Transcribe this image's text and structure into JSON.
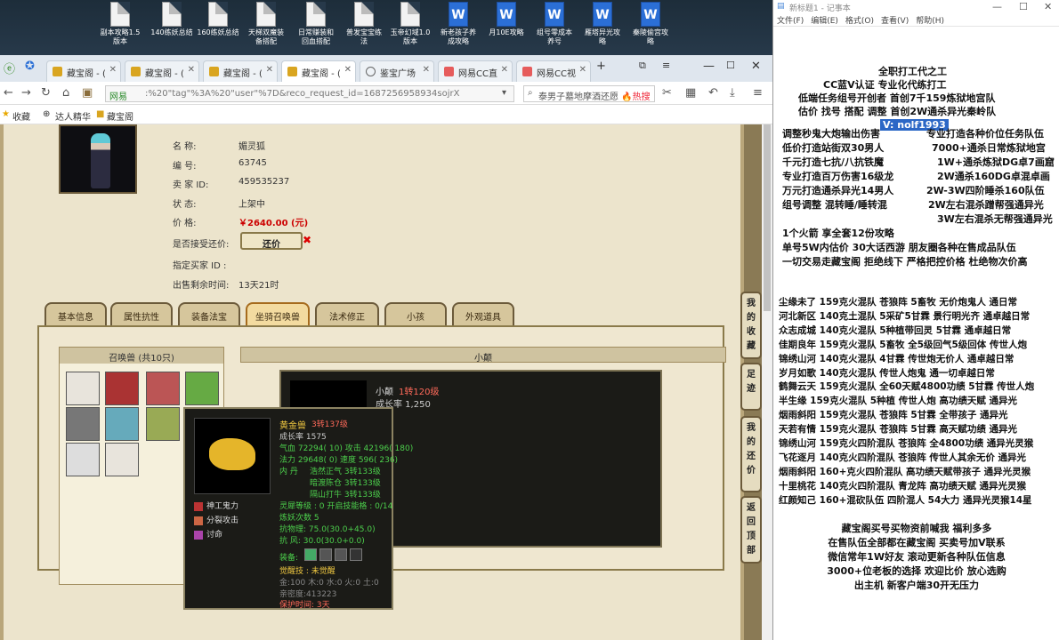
{
  "desktop": {
    "icons": [
      {
        "label": "副本攻略1.5\n版本",
        "icon": "doc-icon",
        "word": false
      },
      {
        "label": "140练妖总结",
        "icon": "doc-icon",
        "word": false
      },
      {
        "label": "160练妖总结",
        "icon": "doc-icon",
        "word": false
      },
      {
        "label": "天梯双魔装\n备搭配",
        "icon": "doc-icon",
        "word": false
      },
      {
        "label": "日常赚装和\n回血搭配",
        "icon": "doc-icon",
        "word": false
      },
      {
        "label": "普发宝宝练\n法",
        "icon": "doc-icon",
        "word": false
      },
      {
        "label": "玉帝幻域1.0\n版本",
        "icon": "doc-icon",
        "word": false
      },
      {
        "label": "新老孩子养\n成攻略",
        "icon": "word-icon",
        "word": true
      },
      {
        "label": "月10E攻略",
        "icon": "word-icon",
        "word": true
      },
      {
        "label": "组号零成本\n养号",
        "icon": "word-icon",
        "word": true
      },
      {
        "label": "雁塔异光攻\n略",
        "icon": "word-icon",
        "word": true
      },
      {
        "label": "秦陵偷宫攻\n略",
        "icon": "word-icon",
        "word": true
      }
    ]
  },
  "browser": {
    "tabs": [
      {
        "label": "藏宝阁 - (",
        "active": false
      },
      {
        "label": "藏宝阁 - (",
        "active": false
      },
      {
        "label": "藏宝阁 - (",
        "active": false
      },
      {
        "label": "藏宝阁 - (",
        "active": true
      },
      {
        "label": "鉴宝广场",
        "active": false
      },
      {
        "label": "网易CC直",
        "active": false
      },
      {
        "label": "网易CC视",
        "active": false
      }
    ],
    "new_tab": "+",
    "address": {
      "site": "网易",
      "url": ":%20\"tag\"%3A%20\"user\"%7D&reco_request_id=1687256958934sojrX"
    },
    "search": {
      "text": "泰男子墓地摩酒还愿",
      "hot": "🔥热搜"
    },
    "bookmarks": [
      "收藏",
      "达人精华",
      "藏宝阁"
    ]
  },
  "item": {
    "labels": [
      "名      称:",
      "编      号:",
      "卖  家  ID:",
      "状      态:",
      "价      格:",
      "是否接受还价:",
      "指定买家 ID :",
      "出售剩余时间:"
    ],
    "name": "媚灵狐",
    "number": "63745",
    "seller_id": "459535237",
    "status": "上架中",
    "price": "￥2640.00 (元)",
    "offer_button": "还价",
    "offer_close": "✖",
    "remaining": "13天21时"
  },
  "game_tabs": [
    "基本信息",
    "属性抗性",
    "装备法宝",
    "坐骑召唤兽",
    "法术修正",
    "小孩",
    "外观道具"
  ],
  "summon_list": {
    "header": "召唤兽 (共10只)"
  },
  "detail_header": "小颠",
  "tooltip_back": {
    "name": "小颠",
    "level": "1转120级",
    "growth": "成长率 1,250"
  },
  "tooltip": {
    "name": "黄金兽",
    "level": "3转137级",
    "growth": "成长率 1575",
    "stats": [
      "气血 72294( 10) 攻击 42196( 180)",
      "法力 29648( 0) 速度 596( 236)"
    ],
    "neidan_label": "内   丹",
    "neidan": [
      "浩然正气 3转133级",
      "暗渡陈仓 3转133级",
      "隔山打牛 3转133级"
    ],
    "skills": [
      "神工鬼力",
      "分裂攻击",
      "讨命"
    ],
    "lingshi": "灵犀等级 : 0  开启技能格 : 0/14",
    "lianyao": "炼妖次数 5",
    "resist1": "抗物理: 75.0(30.0+45.0)",
    "resist2": "抗   风: 30.0(30.0+0.0)",
    "equip_label": "装备:",
    "awaken": "觉醒技 :  未觉醒",
    "elements": "金:100 木:0 水:0 火:0 土:0",
    "intimacy": "亲密度:413223",
    "protect": "保护时间:   3天"
  },
  "side_buttons": [
    "我\n的\n收\n藏",
    "足\n迹",
    "我\n的\n还\n价",
    "返\n回\n顶\n部"
  ],
  "notepad": {
    "title": "新标题1 - 记事本",
    "menu": [
      "文件(F)",
      "编辑(E)",
      "格式(O)",
      "查看(V)",
      "帮助(H)"
    ],
    "lines_top": [
      "全职打工代之工",
      "CC蓝V认证   专业化代练打工",
      "低端任务组号开创者        首创7千159炼狱地宫队",
      "估价 找号 搭配 调整       首创2W通杀异光秦岭队"
    ],
    "selected": "V: nolf1993",
    "lines_left": [
      "调整秒鬼大炮输出伤害",
      "低价打造站街双30男人",
      "千元打造七抗/八抗铁魔",
      "专业打造百万伤害16级龙",
      "万元打造通杀异光14男人",
      "组号调整 混转睡/睡转混"
    ],
    "lines_right": [
      "专业打造各种价位任务队伍",
      "7000+通杀日常炼狱地宫",
      "1W+通杀炼狱DG卓7画窟",
      "2W通杀160DG卓混卓画",
      "2W-3W四阶睡杀160队伍",
      "2W左右混杀蹭帮强通异光",
      "3W左右混杀无帮强通异光"
    ],
    "lines_mid": [
      "1个火箭 享全套12份攻略",
      "单号5W内估价 30大话西游       朋友圈各种在售成品队伍",
      "一切交易走藏宝阁 拒绝线下    严格把控价格 杜绝物次价高"
    ],
    "lines_list": [
      "尘缘未了 159克火混队 苍狼阵 5畜牧 无价炮鬼人 通日常",
      "河北新区 140克土混队 5采矿5甘霖 景行明光齐 通卓越日常",
      "众志成城 140克火混队 5种植带回灵 5甘霖 通卓越日常",
      "佳期良年 159克火混队 5畜牧 全5级回气5级回体 传世人炮",
      "锦绣山河 140克火混队 4甘霖 传世炮无价人 通卓越日常",
      "岁月如歌 140克火混队 传世人炮鬼 通一切卓越日常",
      "鹤舞云天 159克火混队 全60天赋4800功绩 5甘霖 传世人炮",
      "半生缘    159克火混队 5种植 传世人炮 高功绩天赋 通异光",
      "烟雨斜阳 159克火混队 苍狼阵 5甘霖 全带孩子 通异光",
      "天若有情 159克火混队 苍狼阵 5甘霖 高天赋功绩 通异光",
      "锦绣山河 159克火四阶混队 苍狼阵 全4800功绩 通异光灵猴",
      "飞花逐月 140克火四阶混队 苍狼阵 传世人其余无价 通异光",
      "烟雨斜阳 160+克火四阶混队 高功绩天赋带孩子 通异光灵猴",
      "十里桃花 140克火四阶混队 青龙阵 高功绩天赋 通异光灵猴",
      "红颜知己 160+混砍队伍 四阶混人 54大力 通异光灵猴14星"
    ],
    "lines_bottom": [
      "藏宝阁买号买物资前喊我 福利多多",
      "在售队伍全部都在藏宝阁 买卖号加V联系",
      "微信常年1W好友 滚动更新各种队伍信息",
      "3000+位老板的选择 欢迎比价 放心选购",
      "出主机 新客户端30开无压力"
    ]
  }
}
